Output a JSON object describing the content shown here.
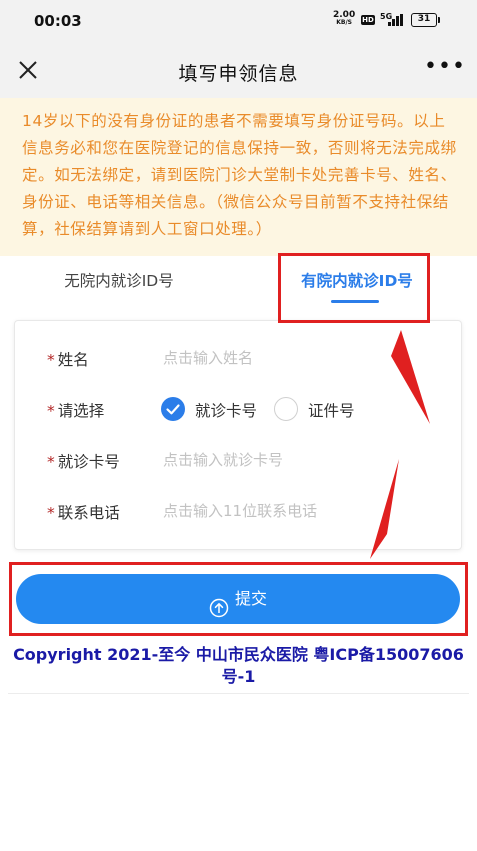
{
  "status_bar": {
    "time": "00:03",
    "net_speed": "2.00",
    "net_unit": "KB/S",
    "hd_badge": "HD",
    "signal_label": "5G",
    "battery": "31"
  },
  "header": {
    "title": "填写申领信息",
    "close_icon": "close-icon",
    "more_icon": "more-icon",
    "more_glyph": "•••"
  },
  "notice": {
    "text": "14岁以下的没有身份证的患者不需要填写身份证号码。以上信息务必和您在医院登记的信息保持一致，否则将无法完成绑定。如无法绑定，请到医院门诊大堂制卡处完善卡号、姓名、身份证、电话等相关信息。（微信公众号目前暂不支持社保结算，社保结算请到人工窗口处理。）"
  },
  "tabs": [
    {
      "label": "无院内就诊ID号",
      "active": false
    },
    {
      "label": "有院内就诊ID号",
      "active": true
    }
  ],
  "form": {
    "required_mark": "*",
    "name": {
      "label": "姓名",
      "placeholder": "点击输入姓名",
      "value": ""
    },
    "select": {
      "label": "请选择",
      "options": [
        {
          "label": "就诊卡号",
          "checked": true
        },
        {
          "label": "证件号",
          "checked": false
        }
      ]
    },
    "card_no": {
      "label": "就诊卡号",
      "placeholder": "点击输入就诊卡号",
      "value": ""
    },
    "phone": {
      "label": "联系电话",
      "placeholder": "点击输入11位联系电话",
      "value": ""
    }
  },
  "submit": {
    "label": "提交",
    "icon": "upload-circle-icon"
  },
  "footer": {
    "copyright": "Copyright 2021-至今 中山市民众医院 粤ICP备15007606号-1"
  },
  "colors": {
    "accent": "#2b7de9",
    "button": "#2489f0",
    "notice_bg": "#fdf6e2",
    "notice_text": "#e98b2a",
    "required": "#b32727",
    "annotation": "#e02020",
    "footer_text": "#1a1aa6"
  }
}
